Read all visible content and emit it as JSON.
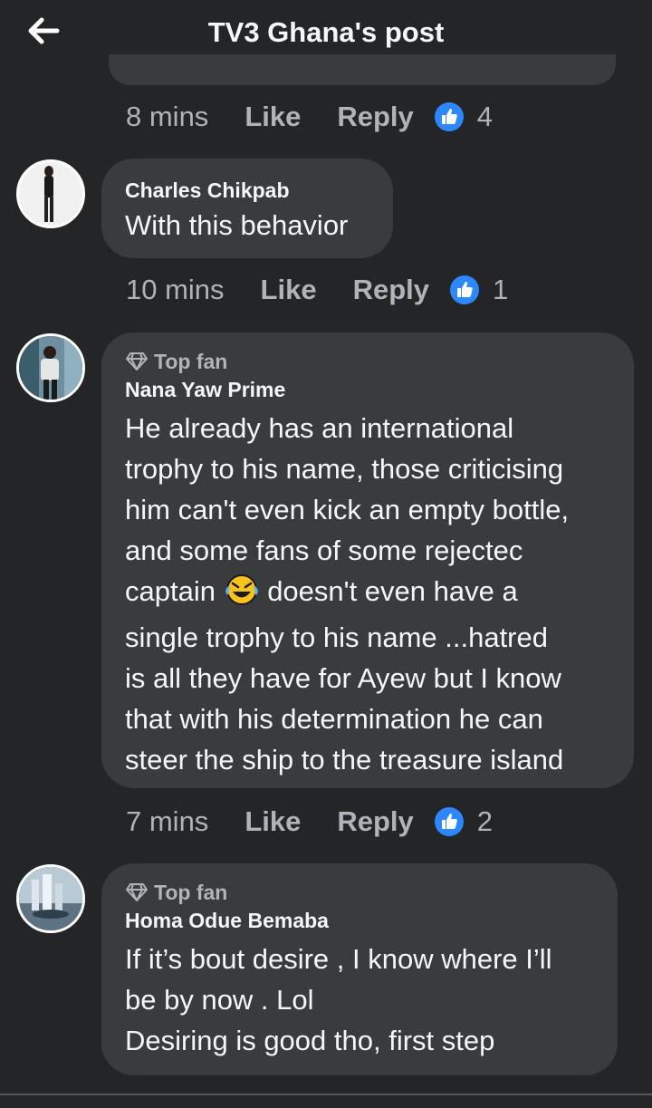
{
  "header": {
    "title": "TV3 Ghana's post"
  },
  "colors": {
    "background": "#242526",
    "bubble": "#3a3b3c",
    "like_blue": "#2d88ff",
    "text": "#e4e6eb",
    "muted": "#b0b3b8"
  },
  "first_actions": {
    "time": "8 mins",
    "like": "Like",
    "reply": "Reply",
    "reactions": "4"
  },
  "comments": [
    {
      "author": "Charles Chikpab",
      "text": "With this behavior",
      "time": "10 mins",
      "like": "Like",
      "reply": "Reply",
      "reactions": "1"
    },
    {
      "badge": "Top fan",
      "author": "Nana Yaw Prime",
      "text_before_emoji": "He already has an international\ntrophy to his name, those criticising\nhim can't even kick an empty bottle,\nand some fans of some rejectec\ncaptain ",
      "emoji": "rolling-laughing-emoji",
      "text_after_emoji": " doesn't even have a\nsingle trophy to his name ...hatred\nis all they have for Ayew but I know\nthat with his determination he can\nsteer the ship to the treasure island",
      "time": "7 mins",
      "like": "Like",
      "reply": "Reply",
      "reactions": "2"
    },
    {
      "badge": "Top fan",
      "author": "Homa Odue Bemaba",
      "text": "If it’s bout desire , I know where I’ll\nbe by now . Lol\nDesiring is good tho, first step"
    }
  ]
}
